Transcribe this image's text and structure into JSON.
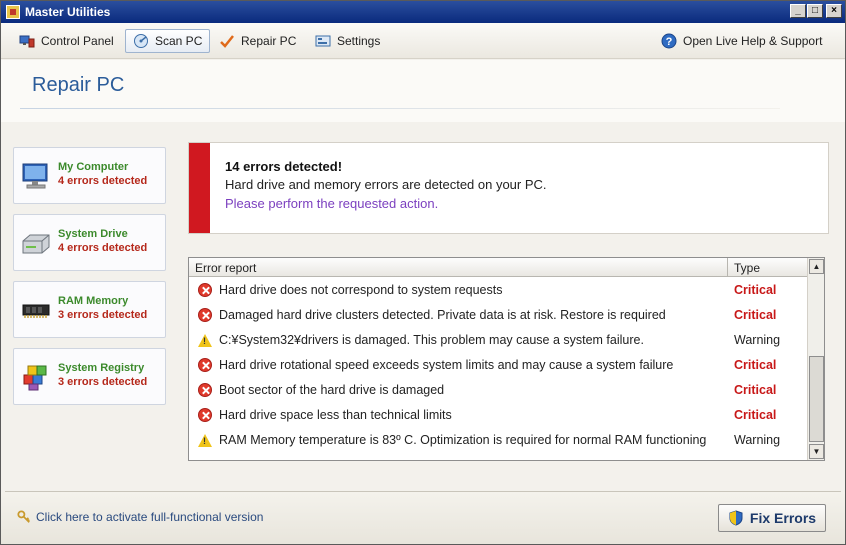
{
  "window": {
    "title": "Master Utilities",
    "controls": [
      "_",
      "□",
      "×"
    ]
  },
  "toolbar": {
    "items": [
      {
        "label": "Control Panel",
        "icon": "control-panel-icon"
      },
      {
        "label": "Scan PC",
        "icon": "scan-pc-icon",
        "active": true
      },
      {
        "label": "Repair PC",
        "icon": "repair-checkmark-icon"
      },
      {
        "label": "Settings",
        "icon": "settings-icon"
      }
    ],
    "help": {
      "label": "Open Live Help & Support",
      "icon": "help-icon"
    }
  },
  "page": {
    "title": "Repair PC"
  },
  "sidebar": {
    "items": [
      {
        "name": "My Computer",
        "count": "4 errors detected",
        "icon": "computer-icon"
      },
      {
        "name": "System Drive",
        "count": "4 errors detected",
        "icon": "drive-icon"
      },
      {
        "name": "RAM Memory",
        "count": "3 errors detected",
        "icon": "ram-chip-icon"
      },
      {
        "name": "System Registry",
        "count": "3 errors detected",
        "icon": "registry-icon"
      }
    ]
  },
  "alert": {
    "title": "14 errors detected!",
    "message": "Hard drive and memory errors are detected on your PC.",
    "action": "Please perform the requested action.",
    "accent_color": "#d01820"
  },
  "report": {
    "columns": [
      "Error report",
      "Type"
    ],
    "rows": [
      {
        "desc": "Hard drive does not correspond to system requests",
        "type": "Critical",
        "severity": "error"
      },
      {
        "desc": "Damaged hard drive clusters detected. Private data is at risk. Restore is required",
        "type": "Critical",
        "severity": "error"
      },
      {
        "desc": "C:¥System32¥drivers is damaged. This problem may cause a system failure.",
        "type": "Warning",
        "severity": "warning"
      },
      {
        "desc": "Hard drive rotational speed exceeds system limits and may cause a system failure",
        "type": "Critical",
        "severity": "error"
      },
      {
        "desc": "Boot sector of the hard drive is damaged",
        "type": "Critical",
        "severity": "error"
      },
      {
        "desc": "Hard drive space less than technical limits",
        "type": "Critical",
        "severity": "error"
      },
      {
        "desc": "RAM Memory temperature is 83º C. Optimization is required for normal RAM functioning",
        "type": "Warning",
        "severity": "warning"
      }
    ]
  },
  "footer": {
    "activate": "Click here to activate full-functional version",
    "fix_button": "Fix Errors"
  },
  "colors": {
    "critical": "#c81818",
    "ok_green": "#3c8a2c",
    "title_blue": "#2b5c9a",
    "link_purple": "#7b3fbf"
  }
}
